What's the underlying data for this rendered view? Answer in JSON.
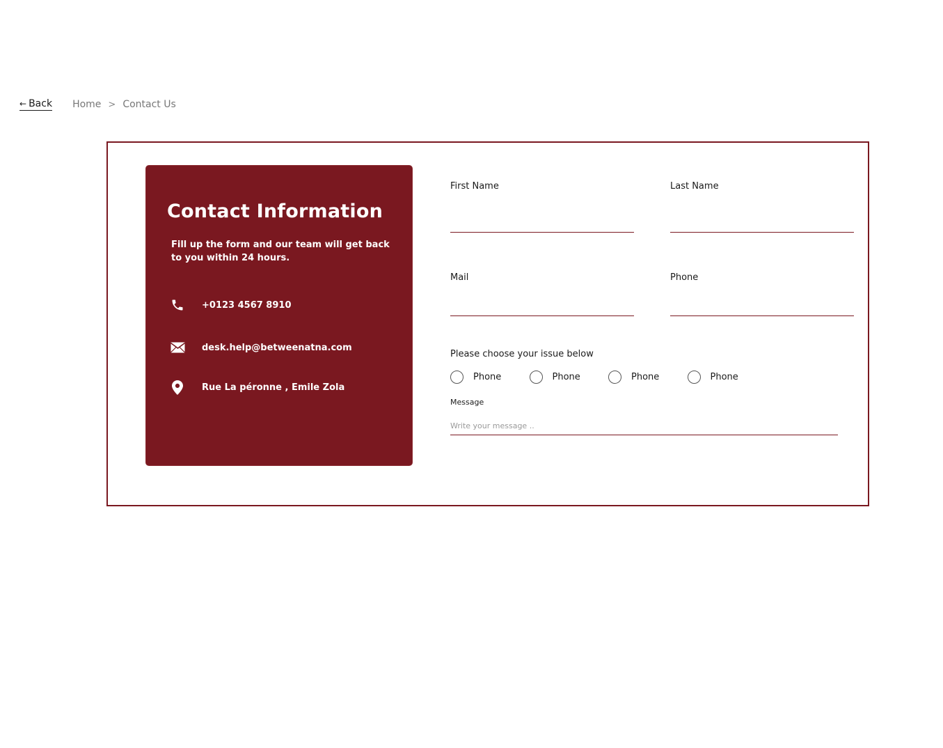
{
  "nav": {
    "back_arrow": "←",
    "back_label": "Back",
    "breadcrumb": {
      "home": "Home",
      "separator": ">",
      "current": "Contact Us"
    }
  },
  "info_card": {
    "title": "Contact Information",
    "subtitle": "Fill up the form and our team will get back to you within 24 hours.",
    "phone": "+0123 4567 8910",
    "email": "desk.help@betweenatna.com",
    "address": "Rue La péronne , Emile Zola",
    "icons": [
      "phone-icon",
      "mail-icon",
      "location-pin-icon"
    ]
  },
  "form": {
    "first_name_label": "First Name",
    "first_name_value": "",
    "last_name_label": "Last Name",
    "last_name_value": "",
    "mail_label": "Mail",
    "mail_value": "",
    "phone_label": "Phone",
    "phone_value": "",
    "issue_label": "Please choose your issue below",
    "issue_options": [
      "Phone",
      "Phone",
      "Phone",
      "Phone"
    ],
    "message_label": "Message",
    "message_placeholder": "Write your message .."
  },
  "colors": {
    "accent": "#7a1820",
    "text": "#1a1a1a",
    "muted": "#777777"
  }
}
